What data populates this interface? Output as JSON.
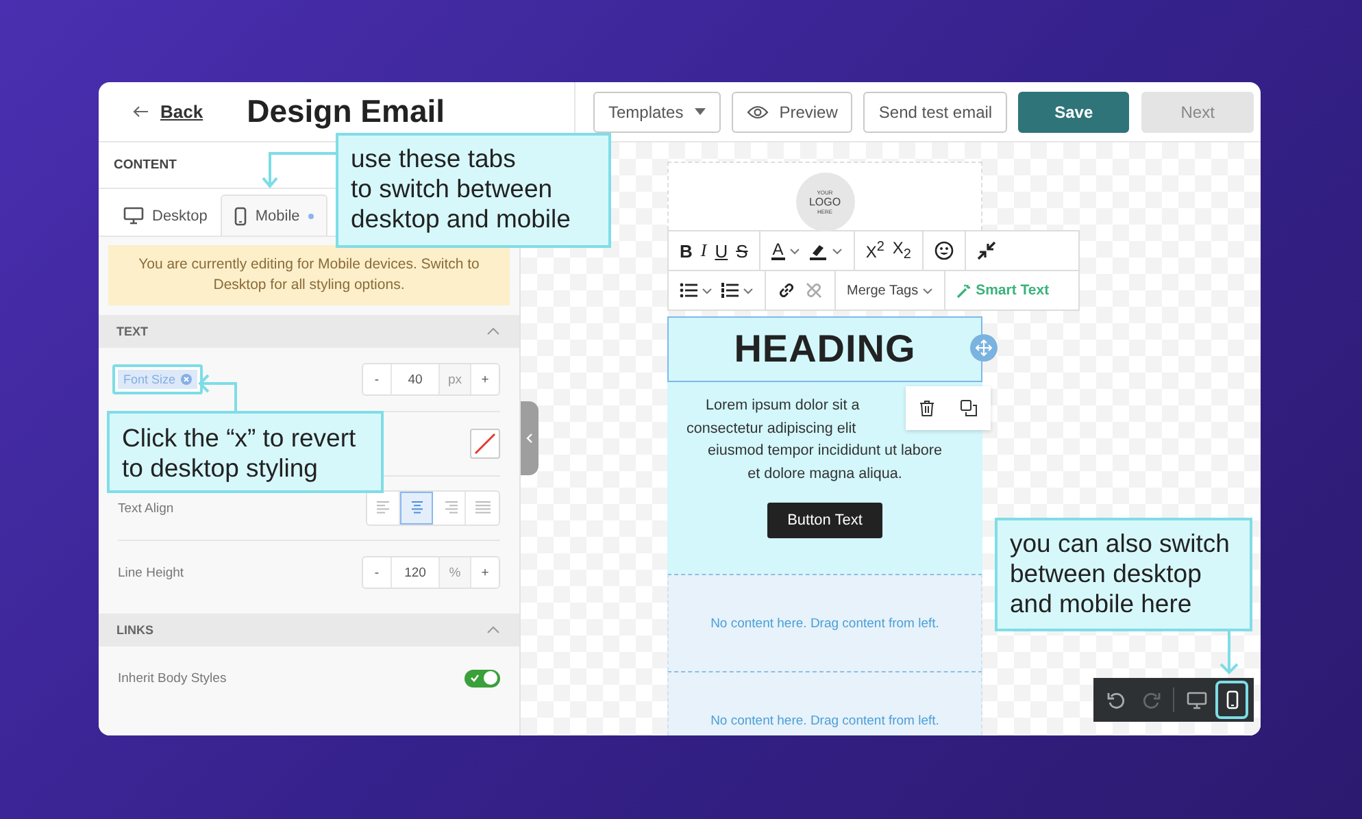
{
  "header": {
    "back": "Back",
    "title": "Design Email",
    "buttons": [
      {
        "label": "Templates",
        "kind": "dropdown"
      },
      {
        "label": "Preview",
        "kind": "preview"
      },
      {
        "label": "Send test email",
        "kind": "outline"
      },
      {
        "label": "Save",
        "kind": "primary"
      },
      {
        "label": "Next",
        "kind": "disabled"
      }
    ]
  },
  "panel": {
    "title": "CONTENT",
    "tabs": [
      {
        "label": "Desktop",
        "kind": "desktop",
        "selected": false,
        "modified": false
      },
      {
        "label": "Mobile",
        "kind": "mobile",
        "selected": true,
        "modified": true
      }
    ],
    "notice": "You are currently editing for Mobile devices. Switch to Desktop for all styling options.",
    "sections": [
      {
        "title": "TEXT",
        "expanded": true,
        "rows": [
          {
            "kind": "stepper",
            "label": "Font Size",
            "overridden": true,
            "highlighted": true,
            "decrement": "-",
            "value": "40",
            "unit": "px",
            "increment": "+"
          },
          {
            "kind": "color",
            "none": true
          },
          {
            "kind": "align",
            "label": "Text Align",
            "options": [
              {
                "kind": "left",
                "selected": false
              },
              {
                "kind": "center",
                "selected": true
              },
              {
                "kind": "right",
                "selected": false
              },
              {
                "kind": "justify",
                "selected": false
              }
            ]
          },
          {
            "kind": "stepper",
            "label": "Line Height",
            "overridden": false,
            "decrement": "-",
            "value": "120",
            "unit": "%",
            "increment": "+"
          }
        ]
      },
      {
        "title": "LINKS",
        "expanded": true,
        "rows": [
          {
            "kind": "toggle",
            "label": "Inherit Body Styles",
            "on": true
          }
        ]
      }
    ]
  },
  "email": {
    "logo": [
      "YOUR",
      "LOGO",
      "HERE"
    ],
    "toolbar": [
      [
        {
          "items": [
            {
              "kind": "bold",
              "label": "B"
            },
            {
              "kind": "italic",
              "label": "I"
            },
            {
              "kind": "underline",
              "label": "U"
            },
            {
              "kind": "strike",
              "label": "S"
            }
          ]
        },
        {
          "items": [
            {
              "kind": "font-color",
              "label": "A",
              "caret": true
            },
            {
              "kind": "highlight",
              "caret": true
            }
          ]
        },
        {
          "items": [
            {
              "kind": "script",
              "label": "X$^{2}$"
            },
            {
              "kind": "script",
              "label": "X$_{2}$"
            }
          ]
        },
        {
          "items": [
            {
              "kind": "emoji"
            }
          ]
        },
        {
          "items": [
            {
              "kind": "collapse"
            }
          ]
        }
      ],
      [
        {
          "items": [
            {
              "kind": "bullets",
              "caret": true
            },
            {
              "kind": "numbers",
              "caret": true
            }
          ]
        },
        {
          "items": [
            {
              "kind": "link"
            },
            {
              "kind": "unlink"
            }
          ]
        },
        {
          "items": [
            {
              "kind": "merge",
              "label": "Merge Tags",
              "caret": true
            }
          ]
        },
        {
          "items": [
            {
              "kind": "smart",
              "label": "Smart Text"
            }
          ]
        }
      ]
    ],
    "heading": "HEADING",
    "body_lines": [
      "Lorem ipsum dolor sit a",
      "consectetur adipiscing elit",
      "eiusmod tempor incididunt ut labore",
      "et dolore magna aliqua."
    ],
    "button": "Button Text",
    "empty_blocks": [
      "No content here. Drag content from left.",
      "No content here. Drag content from left."
    ]
  },
  "view_bar": [
    {
      "kind": "undo",
      "disabled": false,
      "selected": false,
      "highlighted": false
    },
    {
      "kind": "redo",
      "disabled": true,
      "selected": false,
      "highlighted": false
    },
    {
      "kind": "desktop",
      "disabled": false,
      "selected": false,
      "highlighted": false
    },
    {
      "kind": "mobile",
      "disabled": false,
      "selected": true,
      "highlighted": true
    }
  ],
  "callouts": [
    {
      "text": "use these tabs\nto switch between\ndesktop and mobile"
    },
    {
      "text": "Click the “x” to revert\nto desktop styling"
    },
    {
      "text": "you can also switch\nbetween desktop\nand mobile here"
    }
  ]
}
